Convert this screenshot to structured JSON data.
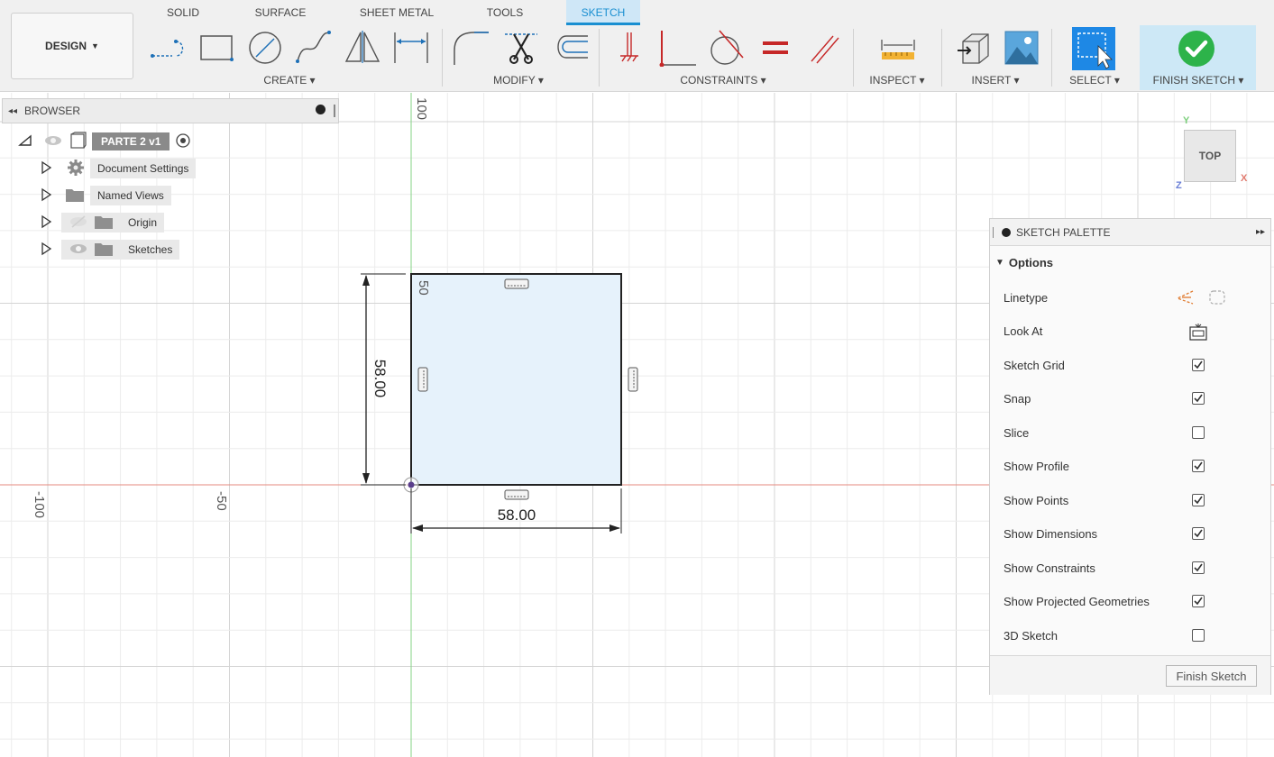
{
  "app": {
    "workspace_label": "DESIGN"
  },
  "tabs": [
    {
      "label": "SOLID"
    },
    {
      "label": "SURFACE"
    },
    {
      "label": "SHEET METAL"
    },
    {
      "label": "TOOLS"
    },
    {
      "label": "SKETCH",
      "active": true
    }
  ],
  "groups": {
    "create": "CREATE",
    "modify": "MODIFY",
    "constraints": "CONSTRAINTS",
    "inspect": "INSPECT",
    "insert": "INSERT",
    "select": "SELECT",
    "finish": "FINISH SKETCH"
  },
  "icons": {
    "create": [
      "line-icon",
      "rectangle-icon",
      "circle-icon",
      "spline-icon",
      "mirror-icon",
      "dimension-icon"
    ],
    "modify": [
      "fillet-icon",
      "trim-icon",
      "offset-icon"
    ],
    "constraints": [
      "fix-icon",
      "coincident-icon",
      "tangent-icon",
      "equal-icon",
      "parallel-icon"
    ],
    "inspect": [
      "measure-icon"
    ],
    "insert": [
      "insert-derive-icon",
      "insert-image-icon"
    ],
    "select": [
      "select-icon"
    ],
    "finish": [
      "finish-check-icon"
    ]
  },
  "browser": {
    "title": "BROWSER",
    "root": "PARTE 2 v1",
    "items": [
      {
        "label": "Document Settings",
        "icon": "gear-icon"
      },
      {
        "label": "Named Views",
        "icon": "folder-icon"
      },
      {
        "label": "Origin",
        "icon": "folder-icon"
      },
      {
        "label": "Sketches",
        "icon": "folder-icon"
      }
    ]
  },
  "canvas": {
    "dimension_horizontal": "58.00",
    "dimension_vertical": "58.00",
    "ruler_labels": {
      "y100": "100",
      "y50": "50",
      "xneg100": "-100",
      "xneg50": "-50"
    },
    "viewcube": {
      "face": "TOP",
      "axis_x": "X",
      "axis_y": "Y",
      "axis_z": "Z"
    }
  },
  "palette": {
    "title": "SKETCH PALETTE",
    "section": "Options",
    "options": [
      {
        "label": "Linetype",
        "kind": "icons"
      },
      {
        "label": "Look At",
        "kind": "icon"
      },
      {
        "label": "Sketch Grid",
        "checked": true
      },
      {
        "label": "Snap",
        "checked": true
      },
      {
        "label": "Slice",
        "checked": false
      },
      {
        "label": "Show Profile",
        "checked": true
      },
      {
        "label": "Show Points",
        "checked": true
      },
      {
        "label": "Show Dimensions",
        "checked": true
      },
      {
        "label": "Show Constraints",
        "checked": true
      },
      {
        "label": "Show Projected Geometries",
        "checked": true
      },
      {
        "label": "3D Sketch",
        "checked": false
      }
    ],
    "finish_button": "Finish Sketch"
  },
  "colors": {
    "accent": "#1a8fd1",
    "axis_x": "#e07a6e",
    "axis_y": "#7ccf7c",
    "profile_fill": "#e6f2fb",
    "finish_green": "#2db34a",
    "select_blue": "#1e88e5"
  }
}
